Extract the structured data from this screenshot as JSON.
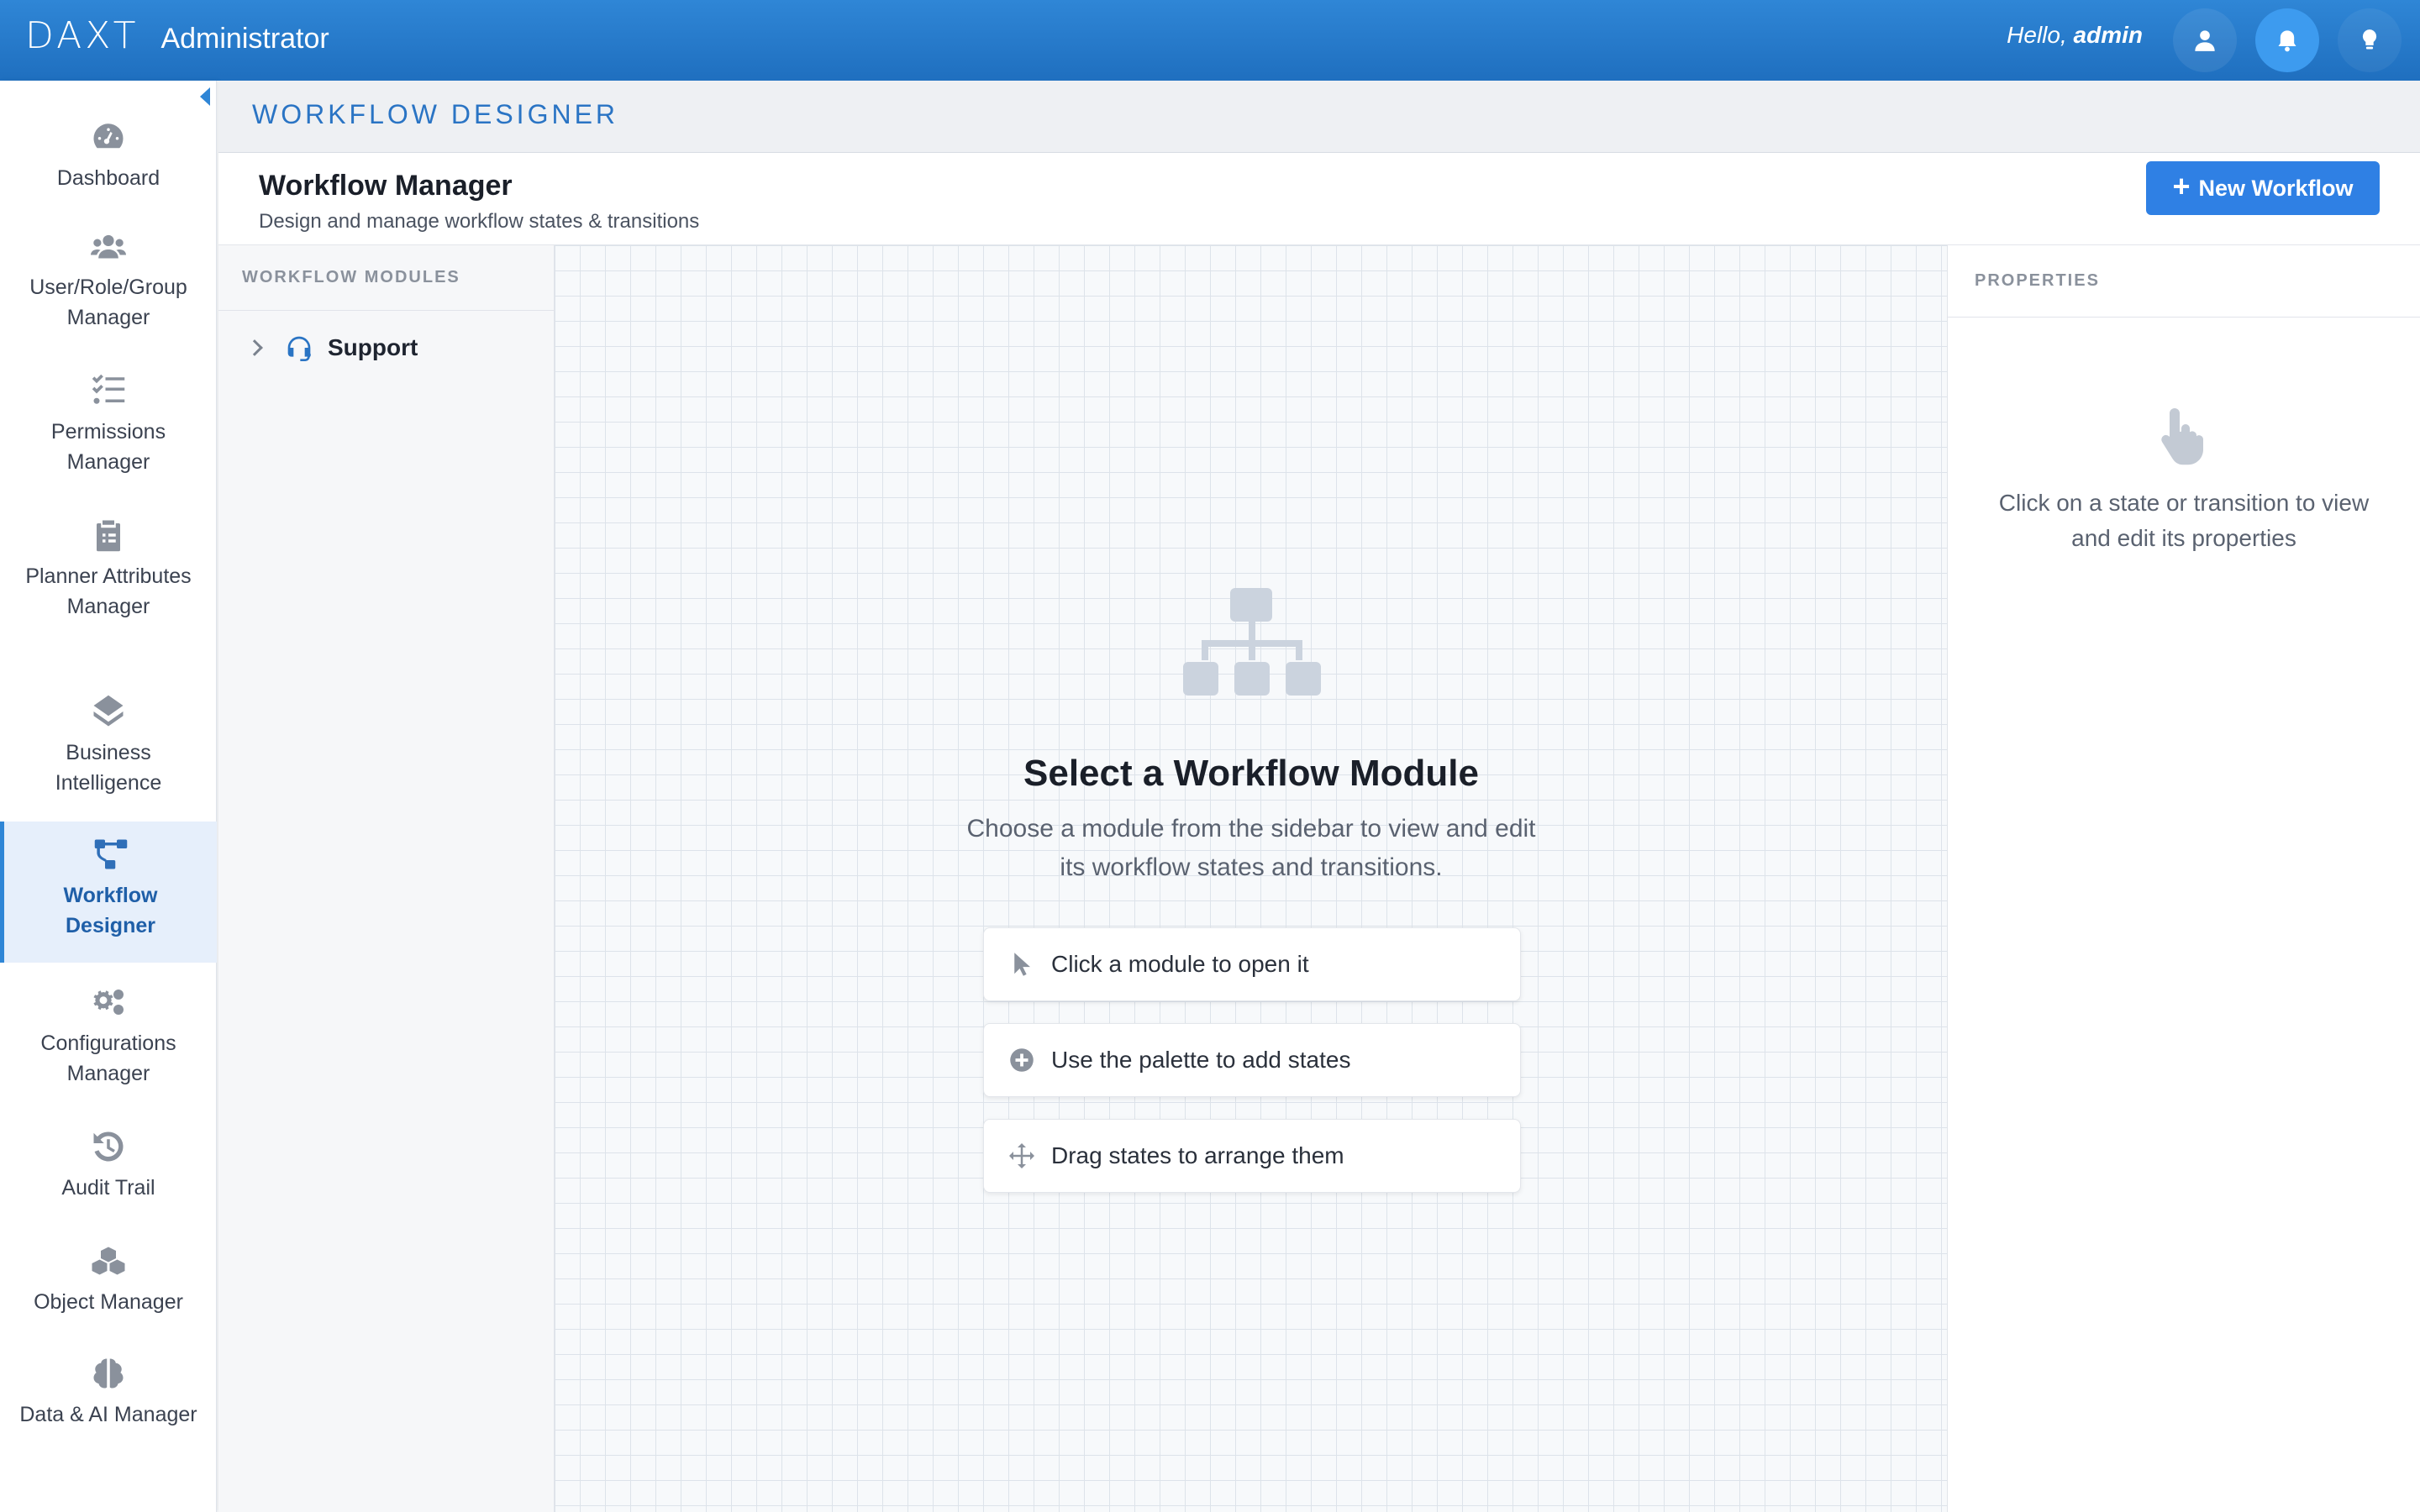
{
  "app": {
    "logo_mark": "DAXT",
    "logo_text": "Administrator",
    "greeting_prefix": "Hello,",
    "greeting_user": "admin"
  },
  "sidebar": {
    "items": [
      {
        "label": "Dashboard",
        "icon": "gauge-icon"
      },
      {
        "label": "User/Role/Group Manager",
        "icon": "users-icon"
      },
      {
        "label": "Permissions Manager",
        "icon": "list-check-icon"
      },
      {
        "label": "Planner Attributes Manager",
        "icon": "clipboard-icon"
      },
      {
        "label": "Business Intelligence",
        "icon": "layers-icon"
      },
      {
        "label": "Workflow Designer",
        "icon": "workflow-icon",
        "active": true
      },
      {
        "label": "Configurations Manager",
        "icon": "gears-icon"
      },
      {
        "label": "Audit Trail",
        "icon": "history-icon"
      },
      {
        "label": "Object Manager",
        "icon": "cubes-icon"
      },
      {
        "label": "Data & AI Manager",
        "icon": "brain-icon"
      }
    ]
  },
  "page": {
    "section_title": "WORKFLOW DESIGNER",
    "title": "Workflow Manager",
    "description": "Design and manage workflow states & transitions",
    "new_button": "New Workflow"
  },
  "modules": {
    "heading": "WORKFLOW MODULES",
    "items": [
      {
        "label": "Support",
        "icon": "headset-icon"
      }
    ]
  },
  "canvas": {
    "empty_title": "Select a Workflow Module",
    "empty_description": "Choose a module from the sidebar to view and edit its workflow states and transitions.",
    "hints": [
      {
        "label": "Click a module to open it",
        "icon": "pointer-icon"
      },
      {
        "label": "Use the palette to add states",
        "icon": "plus-circle-icon"
      },
      {
        "label": "Drag states to arrange them",
        "icon": "move-icon"
      }
    ]
  },
  "properties": {
    "heading": "PROPERTIES",
    "empty_text": "Click on a state or transition to view and edit its properties"
  },
  "colors": {
    "accent": "#2f80e4",
    "topbar": "#1f6fbf"
  }
}
